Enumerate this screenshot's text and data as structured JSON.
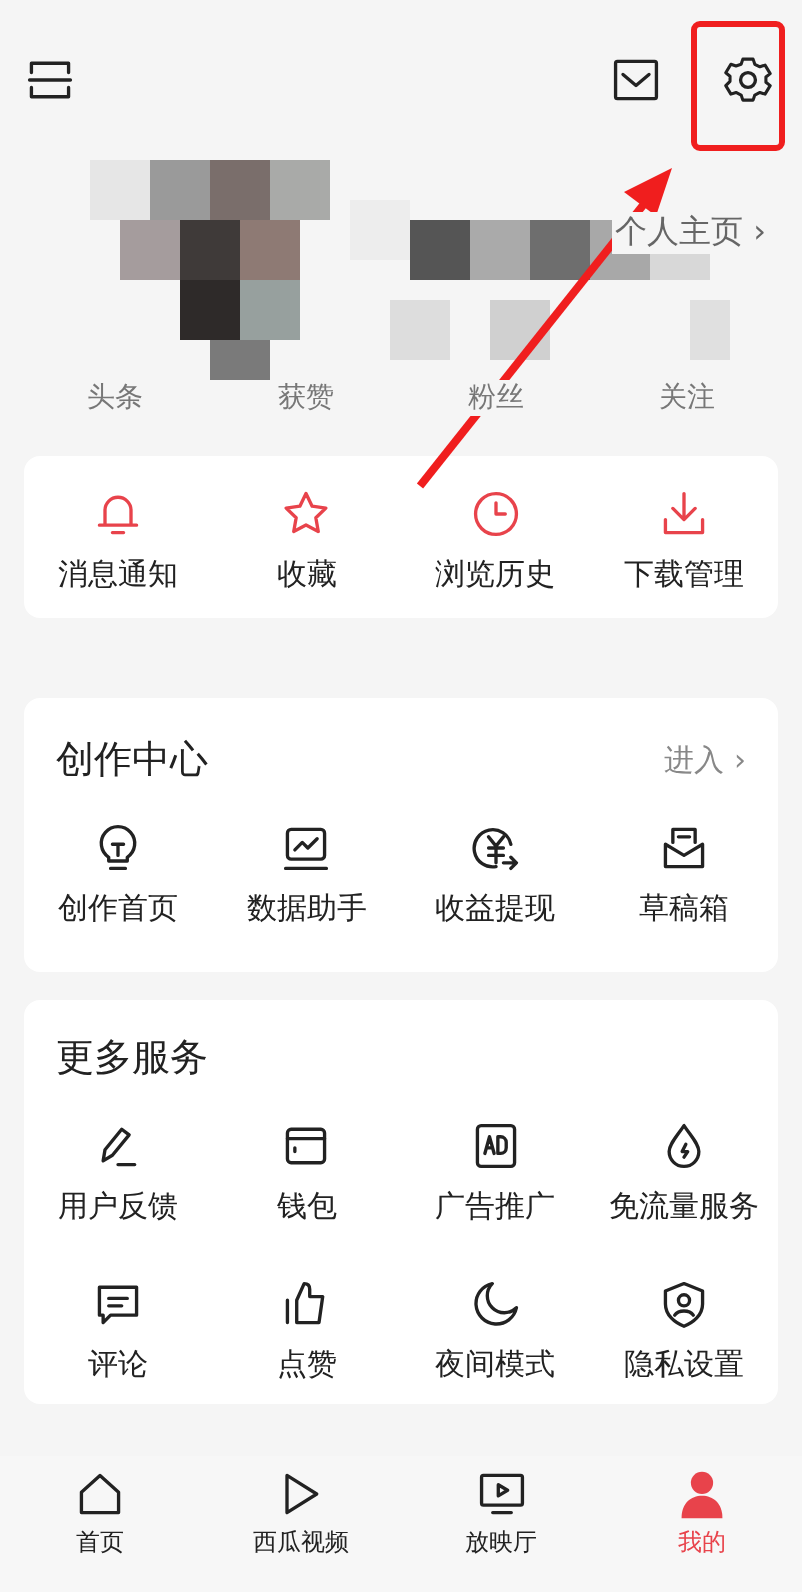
{
  "profile": {
    "homepage_link": "个人主页 ›",
    "stats": [
      {
        "label": "头条"
      },
      {
        "label": "获赞"
      },
      {
        "label": "粉丝"
      },
      {
        "label": "关注"
      }
    ]
  },
  "quick_actions": [
    {
      "label": "消息通知"
    },
    {
      "label": "收藏"
    },
    {
      "label": "浏览历史"
    },
    {
      "label": "下载管理"
    }
  ],
  "creator_center": {
    "title": "创作中心",
    "link": "进入 ›",
    "items": [
      {
        "label": "创作首页"
      },
      {
        "label": "数据助手"
      },
      {
        "label": "收益提现"
      },
      {
        "label": "草稿箱"
      }
    ]
  },
  "more_services": {
    "title": "更多服务",
    "items": [
      {
        "label": "用户反馈"
      },
      {
        "label": "钱包"
      },
      {
        "label": "广告推广"
      },
      {
        "label": "免流量服务"
      },
      {
        "label": "评论"
      },
      {
        "label": "点赞"
      },
      {
        "label": "夜间模式"
      },
      {
        "label": "隐私设置"
      }
    ]
  },
  "tab_bar": [
    {
      "label": "首页",
      "selected": false
    },
    {
      "label": "西瓜视频",
      "selected": false
    },
    {
      "label": "放映厅",
      "selected": false
    },
    {
      "label": "我的",
      "selected": true
    }
  ],
  "annotations": {
    "settings_highlight_box": true,
    "pointer_arrow": true
  }
}
